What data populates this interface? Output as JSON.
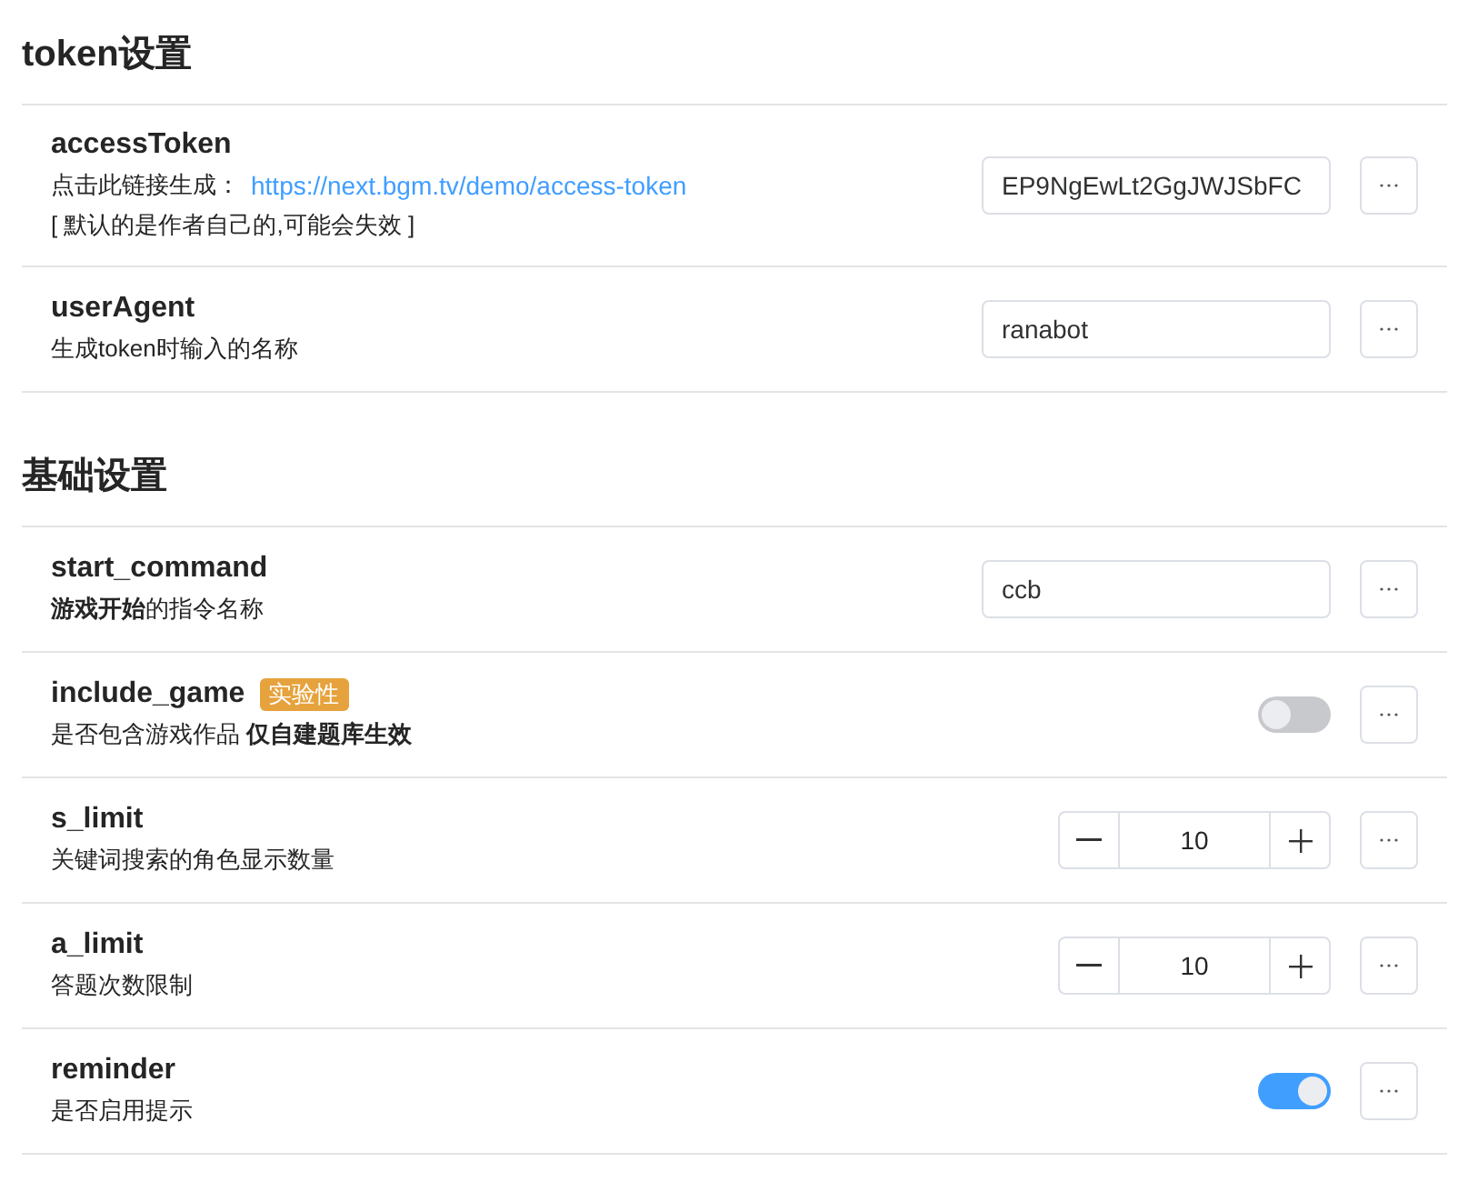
{
  "sections": [
    {
      "title": "token设置",
      "items": [
        {
          "kind": "text",
          "name": "accessToken",
          "lines": [
            {
              "text": "点击此链接生成：",
              "link": "https://next.bgm.tv/demo/access-token"
            },
            {
              "text": "[ 默认的是作者自己的,可能会失效 ]"
            }
          ],
          "value": "EP9NgEwLt2GgJWJSbFC"
        },
        {
          "kind": "text",
          "name": "userAgent",
          "lines": [
            {
              "text": "生成token时输入的名称"
            }
          ],
          "value": "ranabot"
        }
      ]
    },
    {
      "title": "基础设置",
      "items": [
        {
          "kind": "text",
          "name": "start_command",
          "lines": [
            {
              "text": "**游戏开始**的指令名称"
            }
          ],
          "value": "ccb"
        },
        {
          "kind": "switch",
          "name": "include_game",
          "badge": "实验性",
          "lines": [
            {
              "text": "是否包含游戏作品 **仅自建题库生效**"
            }
          ],
          "on": false
        },
        {
          "kind": "number",
          "name": "s_limit",
          "lines": [
            {
              "text": "关键词搜索的角色显示数量"
            }
          ],
          "value": "10"
        },
        {
          "kind": "number",
          "name": "a_limit",
          "lines": [
            {
              "text": "答题次数限制"
            }
          ],
          "value": "10"
        },
        {
          "kind": "switch",
          "name": "reminder",
          "lines": [
            {
              "text": "是否启用提示"
            }
          ],
          "on": true
        }
      ]
    }
  ]
}
